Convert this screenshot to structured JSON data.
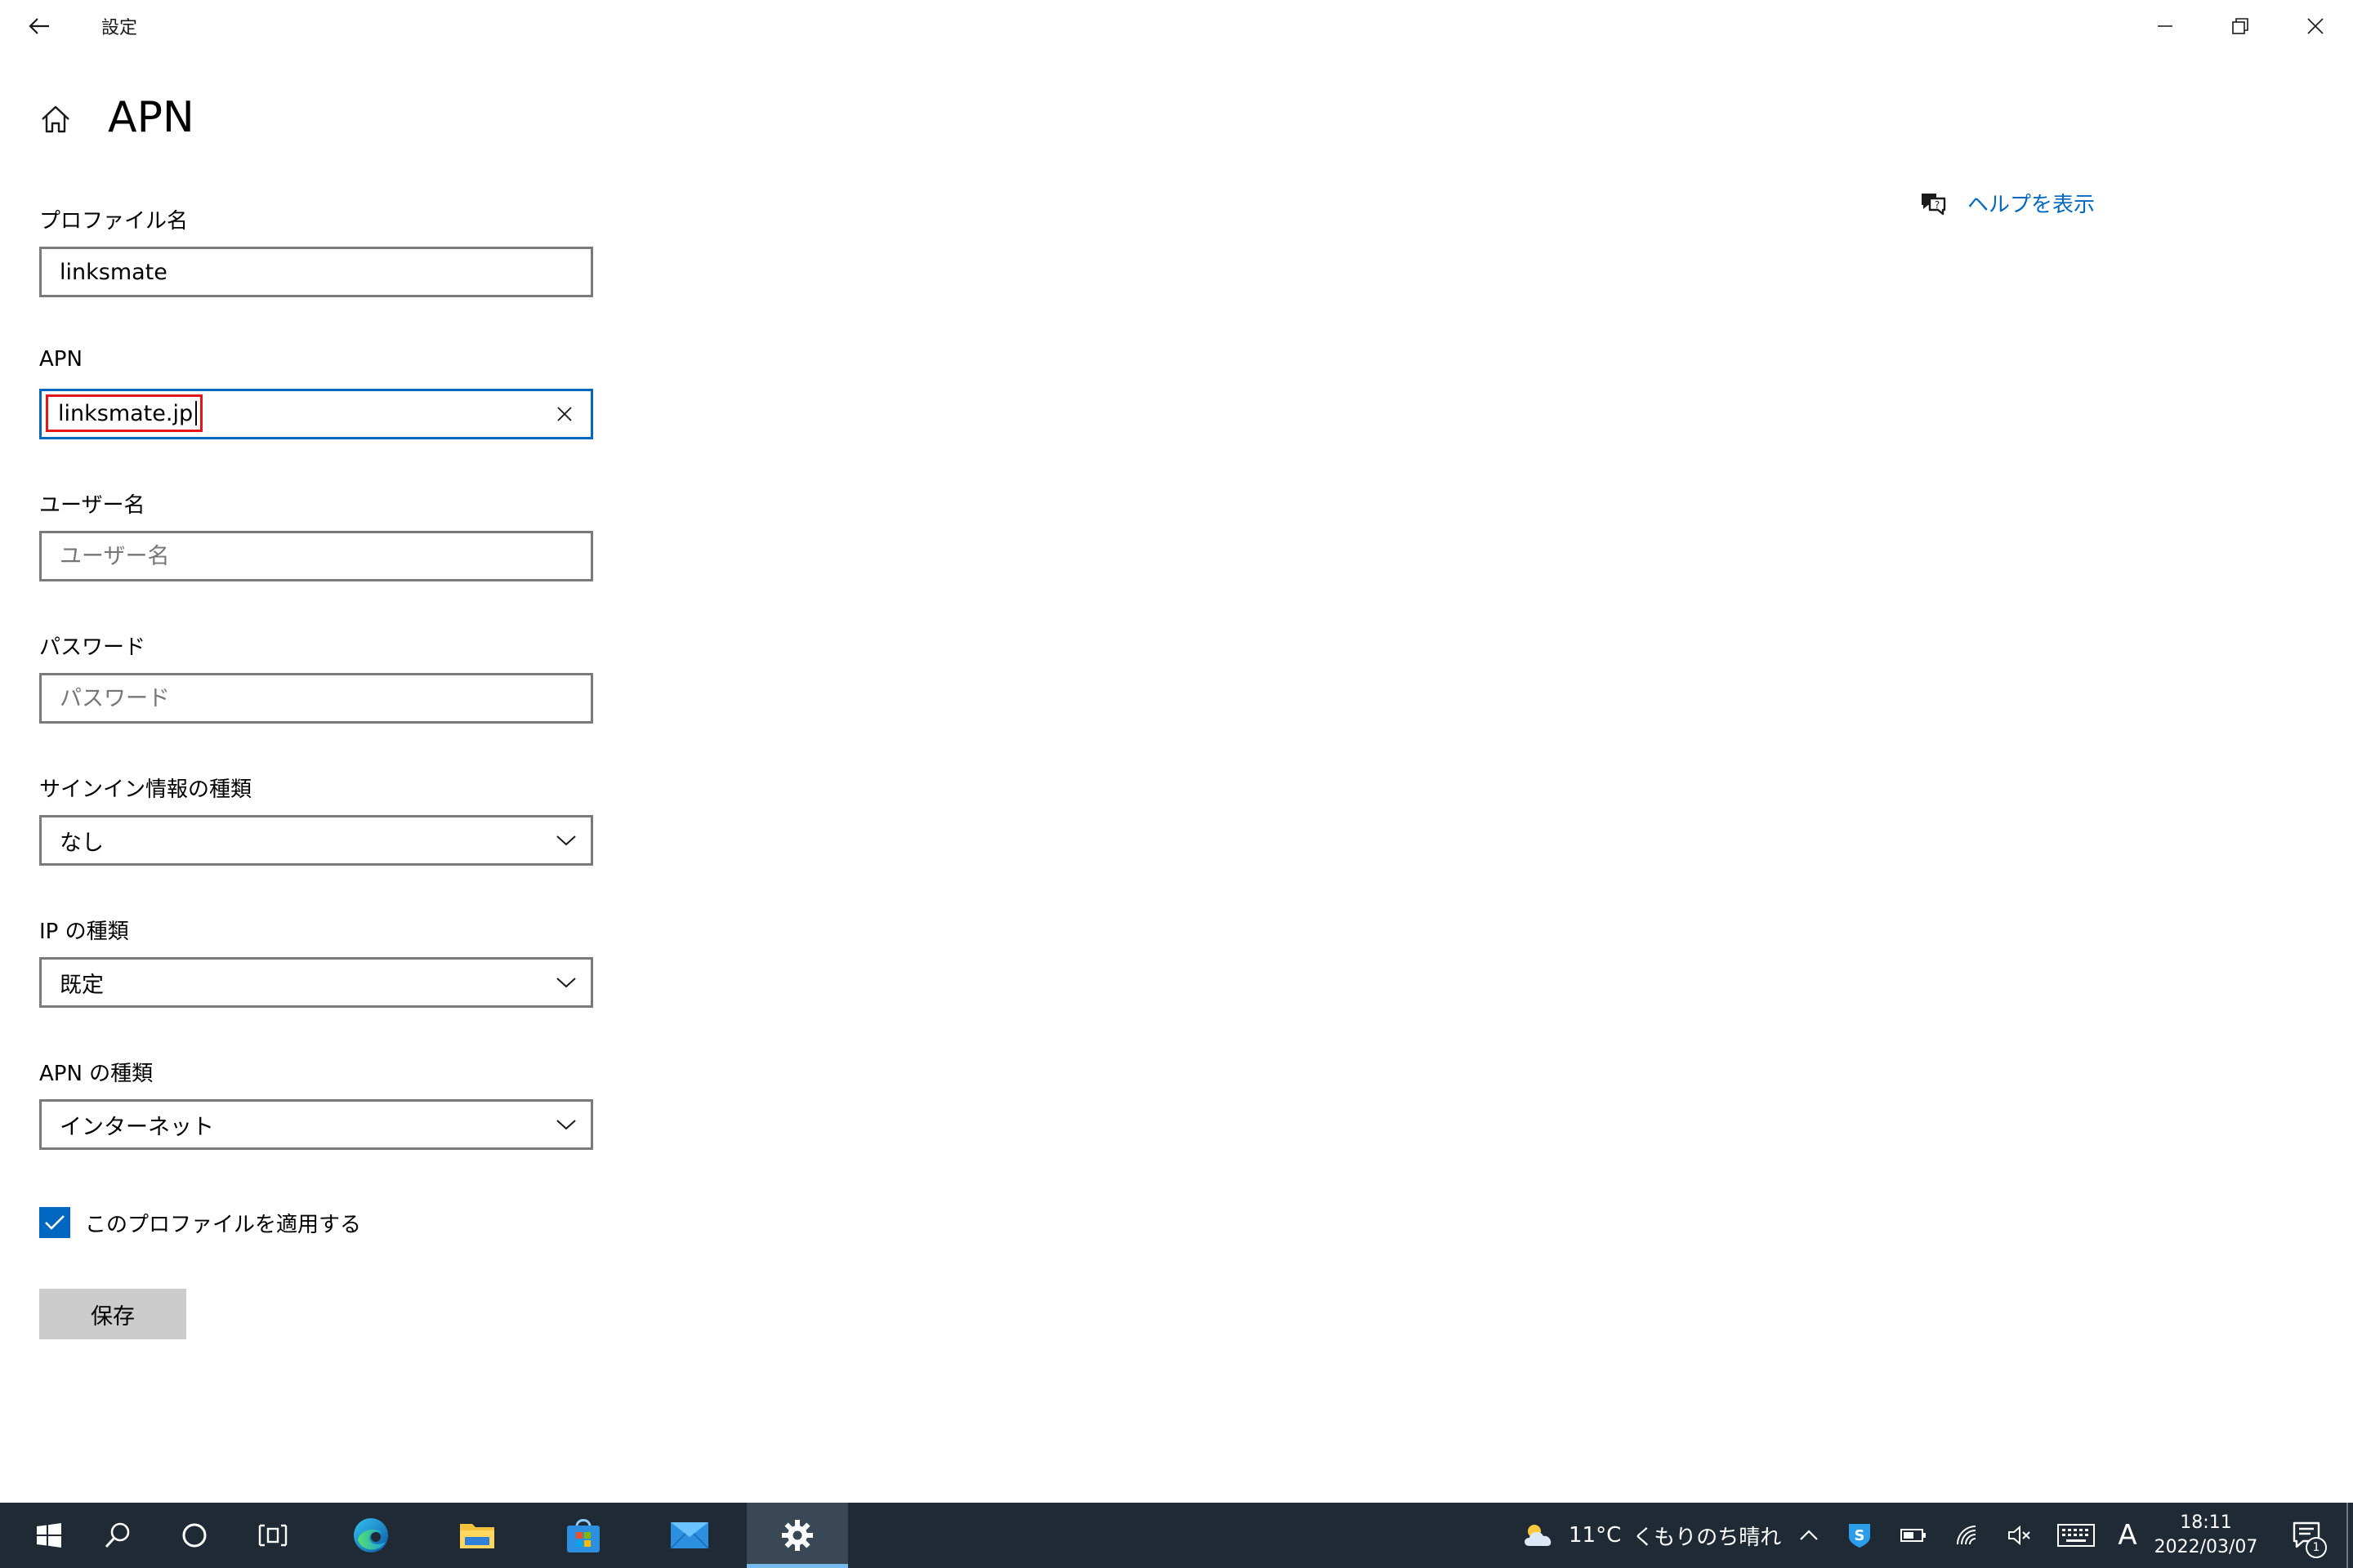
{
  "window": {
    "title": "設定"
  },
  "page": {
    "title": "APN"
  },
  "help": {
    "link_label": "ヘルプを表示"
  },
  "form": {
    "profile_name": {
      "label": "プロファイル名",
      "value": "linksmate"
    },
    "apn": {
      "label": "APN",
      "value": "linksmate.jp"
    },
    "username": {
      "label": "ユーザー名",
      "placeholder": "ユーザー名",
      "value": ""
    },
    "password": {
      "label": "パスワード",
      "placeholder": "パスワード",
      "value": ""
    },
    "sign_in_type": {
      "label": "サインイン情報の種類",
      "selected": "なし"
    },
    "ip_type": {
      "label": "IP の種類",
      "selected": "既定"
    },
    "apn_type": {
      "label": "APN の種類",
      "selected": "インターネット"
    },
    "apply_profile": {
      "label": "このプロファイルを適用する",
      "checked": true
    },
    "save_label": "保存"
  },
  "taskbar": {
    "pinned": [
      "start-icon",
      "search-icon",
      "cortana-icon",
      "task-view-icon",
      "edge-icon",
      "file-explorer-icon",
      "store-icon",
      "mail-icon",
      "settings-icon"
    ],
    "active_app": "settings",
    "weather": {
      "temperature": "11°C",
      "condition": "くもりのち晴れ"
    },
    "ime_mode": "A",
    "clock": {
      "time": "18:11",
      "date": "2022/03/07"
    },
    "notification_count": "1"
  },
  "colors": {
    "accent": "#0067c0",
    "highlight_border": "#e3161b",
    "taskbar_bg": "#1f2a35"
  }
}
